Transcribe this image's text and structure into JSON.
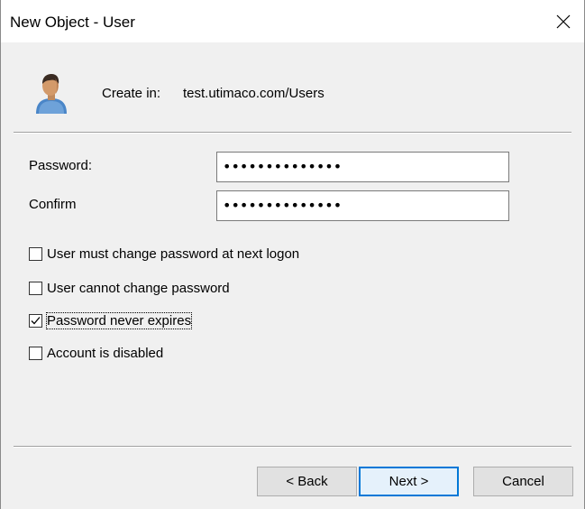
{
  "window": {
    "title": "New Object - User"
  },
  "header": {
    "create_label": "Create in:",
    "create_value": "test.utimaco.com/Users"
  },
  "fields": {
    "password_label": "Password:",
    "password_value": "••••••••••••••",
    "confirm_label": "Confirm",
    "confirm_value": "••••••••••••••"
  },
  "options": [
    {
      "label": "User must change password at next logon",
      "checked": false
    },
    {
      "label": "User cannot change password",
      "checked": false
    },
    {
      "label": "Password never expires",
      "checked": true
    },
    {
      "label": "Account is disabled",
      "checked": false
    }
  ],
  "buttons": {
    "back": "< Back",
    "next": "Next >",
    "cancel": "Cancel"
  },
  "colors": {
    "dialog_bg": "#f0f0f0",
    "titlebar_bg": "#ffffff",
    "default_button_border": "#0078d7"
  }
}
